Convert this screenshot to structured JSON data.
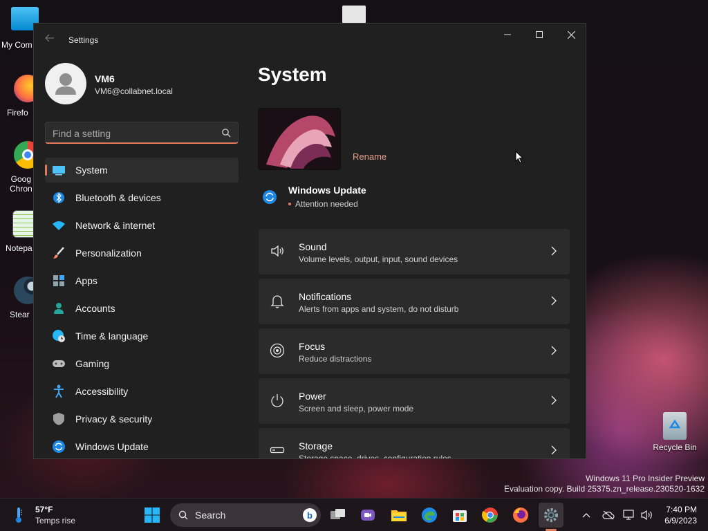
{
  "desktop": {
    "icons": [
      {
        "label": "My Com"
      },
      {
        "label": "Firefo"
      },
      {
        "label": "Goog\nChron"
      },
      {
        "label": "Notepa"
      },
      {
        "label": "Stear"
      },
      {
        "label": "Recycle Bin"
      }
    ],
    "watermark": {
      "line1": "Windows 11 Pro Insider Preview",
      "line2": "Evaluation copy. Build 25375.zn_release.230520-1632"
    }
  },
  "window": {
    "title": "Settings",
    "controls": {
      "minimize": "minimize",
      "maximize": "maximize",
      "close": "close"
    }
  },
  "profile": {
    "name": "VM6",
    "email": "VM6@collabnet.local"
  },
  "search": {
    "placeholder": "Find a setting"
  },
  "nav": {
    "items": [
      {
        "label": "System",
        "icon": "monitor-icon",
        "active": true
      },
      {
        "label": "Bluetooth & devices",
        "icon": "bluetooth-icon"
      },
      {
        "label": "Network & internet",
        "icon": "wifi-icon"
      },
      {
        "label": "Personalization",
        "icon": "brush-icon"
      },
      {
        "label": "Apps",
        "icon": "apps-icon"
      },
      {
        "label": "Accounts",
        "icon": "person-icon"
      },
      {
        "label": "Time & language",
        "icon": "globe-clock-icon"
      },
      {
        "label": "Gaming",
        "icon": "gamepad-icon"
      },
      {
        "label": "Accessibility",
        "icon": "accessibility-icon"
      },
      {
        "label": "Privacy & security",
        "icon": "shield-icon"
      },
      {
        "label": "Windows Update",
        "icon": "update-icon"
      }
    ]
  },
  "main": {
    "title": "System",
    "rename": "Rename",
    "windows_update": {
      "title": "Windows Update",
      "status": "Attention needed"
    },
    "cards": [
      {
        "title": "Sound",
        "subtitle": "Volume levels, output, input, sound devices",
        "icon": "speaker-icon"
      },
      {
        "title": "Notifications",
        "subtitle": "Alerts from apps and system, do not disturb",
        "icon": "bell-icon"
      },
      {
        "title": "Focus",
        "subtitle": "Reduce distractions",
        "icon": "focus-icon"
      },
      {
        "title": "Power",
        "subtitle": "Screen and sleep, power mode",
        "icon": "power-icon"
      },
      {
        "title": "Storage",
        "subtitle": "Storage space, drives, configuration rules",
        "icon": "storage-icon"
      }
    ]
  },
  "taskbar": {
    "weather": {
      "temp": "57°F",
      "desc": "Temps rise"
    },
    "search_label": "Search",
    "clock": {
      "time": "7:40 PM",
      "date": "6/9/2023"
    }
  },
  "colors": {
    "accent": "#e07a5f",
    "window_bg": "#202020",
    "card_bg": "#2b2b2b"
  }
}
